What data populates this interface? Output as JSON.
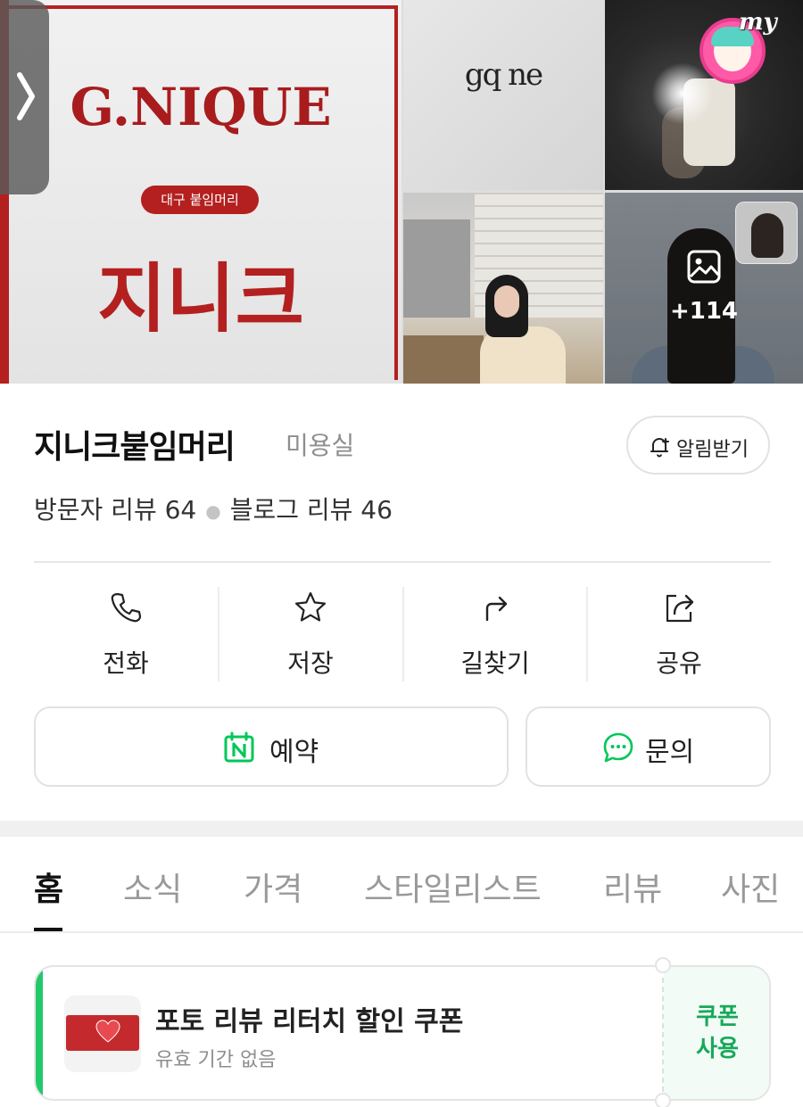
{
  "gallery": {
    "brand_en": "G.NIQUE",
    "brand_tag": "대구 붙임머리",
    "brand_kr": "지니크",
    "logo_mark": "gq ne",
    "more_count": "+114",
    "badge_text": "my"
  },
  "place": {
    "name": "지니크붙임머리",
    "category": "미용실",
    "notify_label": "알림받기",
    "visitor_reviews": "방문자 리뷰 64",
    "blog_reviews": "블로그 리뷰 46"
  },
  "actions": [
    {
      "label": "전화",
      "icon": "phone-icon"
    },
    {
      "label": "저장",
      "icon": "star-icon"
    },
    {
      "label": "길찾기",
      "icon": "directions-icon"
    },
    {
      "label": "공유",
      "icon": "share-icon"
    }
  ],
  "buttons": {
    "reserve": "예약",
    "ask": "문의"
  },
  "tabs": [
    "홈",
    "소식",
    "가격",
    "스타일리스트",
    "리뷰",
    "사진"
  ],
  "coupon": {
    "title": "포토 리뷰 리터치 할인 쿠폰",
    "subtitle": "유효 기간 없음",
    "action_line1": "쿠폰",
    "action_line2": "사용"
  },
  "colors": {
    "brand_red": "#b3201f",
    "accent_green": "#17a85a",
    "naver_green": "#03c75a"
  }
}
